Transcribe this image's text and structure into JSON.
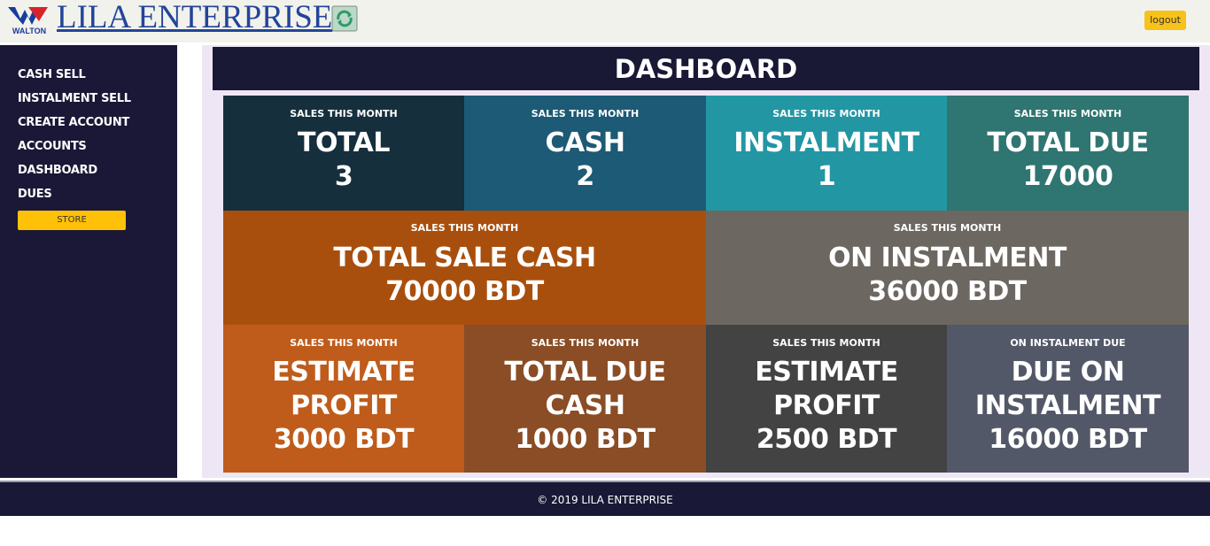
{
  "header": {
    "logo_text": "WALTON",
    "brand": "LILA ENTERPRISE",
    "logout_label": "logout"
  },
  "sidebar": {
    "items": [
      {
        "label": "CASH SELL"
      },
      {
        "label": "INSTALMENT SELL"
      },
      {
        "label": "CREATE ACCOUNT"
      },
      {
        "label": "ACCOUNTS"
      },
      {
        "label": "DASHBOARD"
      },
      {
        "label": "DUES"
      }
    ],
    "store_label": "STORE"
  },
  "main": {
    "title": "DASHBOARD",
    "tiles": [
      {
        "caption": "SALES THIS MONTH",
        "line1": "TOTAL",
        "line2": "3",
        "color": "#152f3d"
      },
      {
        "caption": "SALES THIS MONTH",
        "line1": "CASH",
        "line2": "2",
        "color": "#1c5a75"
      },
      {
        "caption": "SALES THIS MONTH",
        "line1": "INSTALMENT",
        "line2": "1",
        "color": "#2396a3"
      },
      {
        "caption": "SALES THIS MONTH",
        "line1": "TOTAL DUE",
        "line2": "17000",
        "color": "#2f7571"
      },
      {
        "caption": "SALES THIS MONTH",
        "line1": "TOTAL SALE CASH",
        "line2": "70000 BDT",
        "color": "#a94f0e"
      },
      {
        "caption": "SALES THIS MONTH",
        "line1": "ON INSTALMENT",
        "line2": "36000 BDT",
        "color": "#6c6760"
      },
      {
        "caption": "SALES THIS MONTH",
        "line1": "ESTIMATE",
        "line2": "PROFIT",
        "line3": "3000 BDT",
        "color": "#bf5c1b"
      },
      {
        "caption": "SALES THIS MONTH",
        "line1": "TOTAL DUE",
        "line2": "CASH",
        "line3": "1000 BDT",
        "color": "#8a4d25"
      },
      {
        "caption": "SALES THIS MONTH",
        "line1": "ESTIMATE",
        "line2": "PROFIT",
        "line3": "2500 BDT",
        "color": "#434343"
      },
      {
        "caption": "ON INSTALMENT DUE",
        "line1": "DUE ON",
        "line2": "INSTALMENT",
        "line3": "16000 BDT",
        "color": "#525867"
      }
    ]
  },
  "footer": {
    "text": "© 2019 LILA ENTERPRISE"
  }
}
